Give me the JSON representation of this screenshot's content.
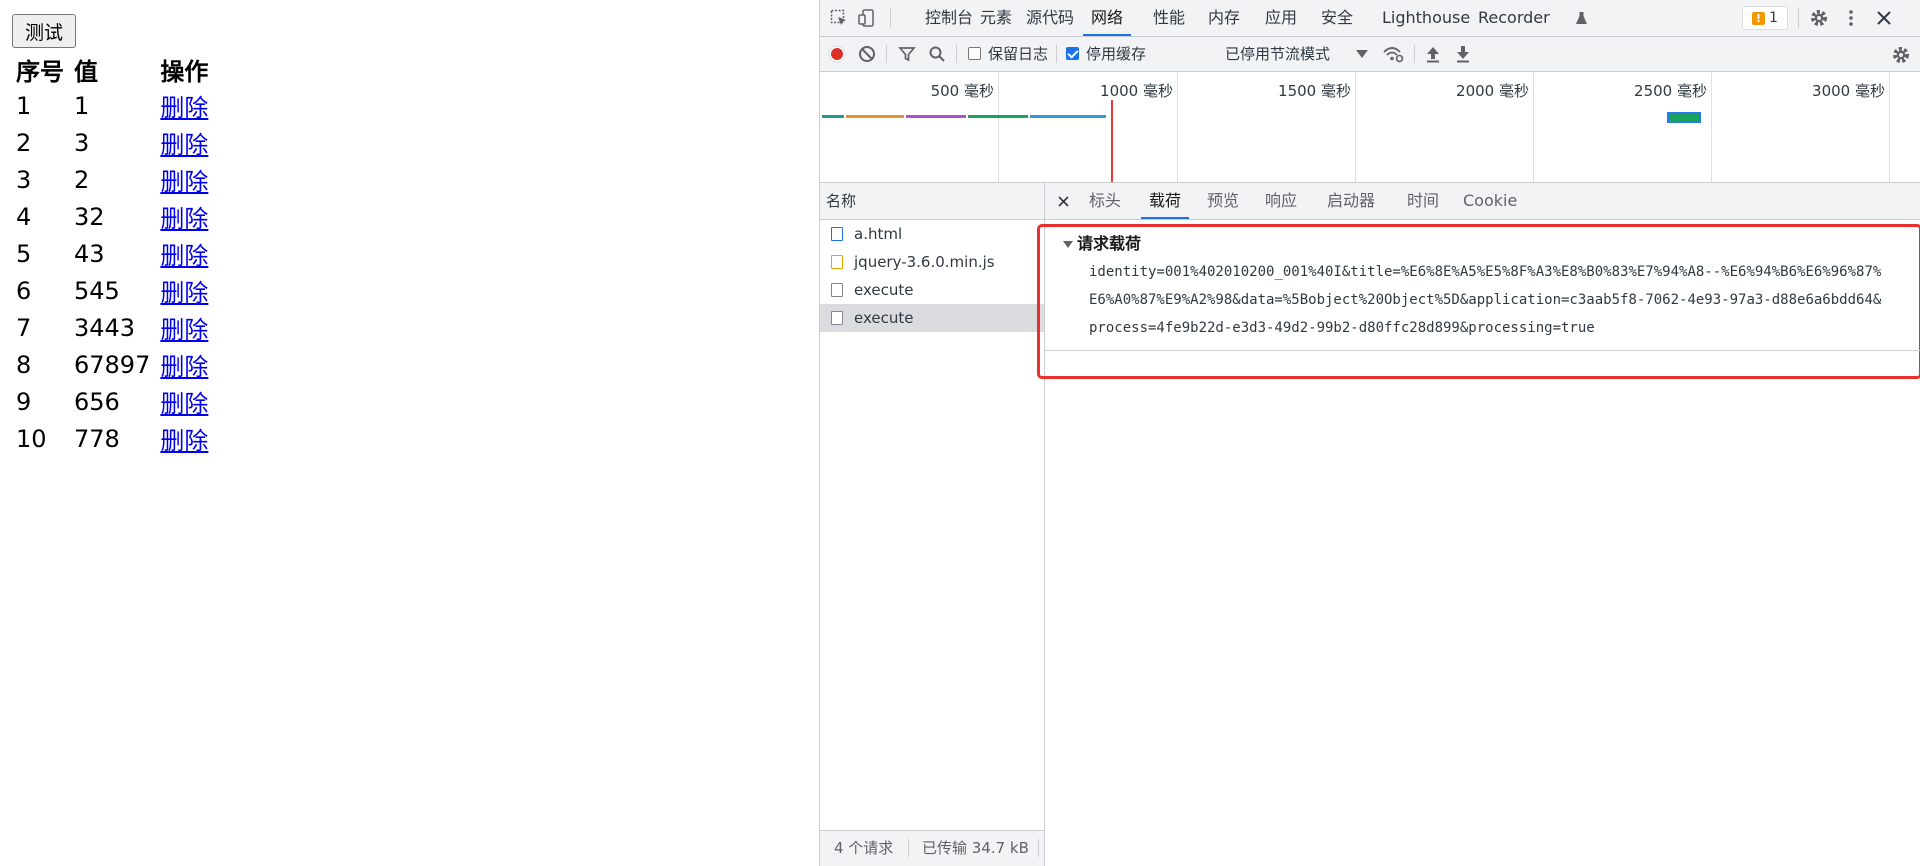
{
  "page": {
    "test_button": "测试",
    "headers": [
      "序号",
      "值",
      "操作"
    ],
    "rows": [
      {
        "index": "1",
        "value": "1",
        "action": "删除"
      },
      {
        "index": "2",
        "value": "3",
        "action": "删除"
      },
      {
        "index": "3",
        "value": "2",
        "action": "删除"
      },
      {
        "index": "4",
        "value": "32",
        "action": "删除"
      },
      {
        "index": "5",
        "value": "43",
        "action": "删除"
      },
      {
        "index": "6",
        "value": "545",
        "action": "删除"
      },
      {
        "index": "7",
        "value": "3443",
        "action": "删除"
      },
      {
        "index": "8",
        "value": "67897",
        "action": "删除"
      },
      {
        "index": "9",
        "value": "656",
        "action": "删除"
      },
      {
        "index": "10",
        "value": "778",
        "action": "删除"
      }
    ]
  },
  "devtools": {
    "tabs": [
      "控制台",
      "元素",
      "源代码",
      "网络",
      "性能",
      "内存",
      "应用",
      "安全",
      "Lighthouse",
      "Recorder"
    ],
    "active_tab": "网络",
    "issues_badge": "1",
    "toolbar": {
      "preserve_log": "保留日志",
      "disable_cache": "停用缓存",
      "throttling": "已停用节流模式"
    },
    "timeline_ticks": [
      "500 毫秒",
      "1000 毫秒",
      "1500 毫秒",
      "2000 毫秒",
      "2500 毫秒",
      "3000 毫秒"
    ],
    "request_list": {
      "header": "名称",
      "items": [
        {
          "name": "a.html",
          "type": "document"
        },
        {
          "name": "jquery-3.6.0.min.js",
          "type": "script"
        },
        {
          "name": "execute",
          "type": "other"
        },
        {
          "name": "execute",
          "type": "other",
          "selected": true
        }
      ],
      "status_requests": "4 个请求",
      "status_transferred": "已传输 34.7 kB"
    },
    "detail_tabs": [
      "标头",
      "载荷",
      "预览",
      "响应",
      "启动器",
      "时间",
      "Cookie"
    ],
    "active_detail_tab": "载荷",
    "payload": {
      "title": "请求载荷",
      "lines": [
        "identity=001%402010200_001%40I&title=%E6%8E%A5%E5%8F%A3%E8%B0%83%E7%94%A8--%E6%94%B6%E6%96%87%",
        "E6%A0%87%E9%A2%98&data=%5Bobject%20Object%5D&application=c3aab5f8-7062-4e93-97a3-d88e6a6bdd64&",
        "process=4fe9b22d-e3d3-49d2-99b2-d80ffc28d899&processing=true"
      ]
    }
  }
}
